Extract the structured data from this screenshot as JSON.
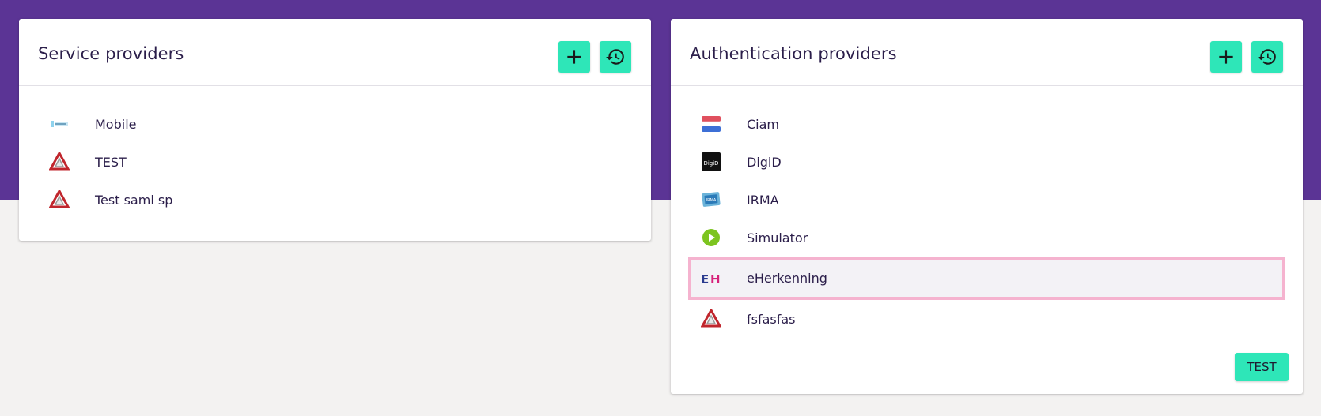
{
  "service_providers": {
    "title": "Service providers",
    "add_icon": "plus-icon",
    "history_icon": "history-icon",
    "items": [
      {
        "label": "Mobile",
        "icon": "mobile-logo-icon"
      },
      {
        "label": "TEST",
        "icon": "saml-logo-icon"
      },
      {
        "label": "Test saml sp",
        "icon": "saml-logo-icon"
      }
    ]
  },
  "authentication_providers": {
    "title": "Authentication providers",
    "add_icon": "plus-icon",
    "history_icon": "history-icon",
    "items": [
      {
        "label": "Ciam",
        "icon": "dutch-flag-icon"
      },
      {
        "label": "DigiD",
        "icon": "digid-logo-icon",
        "logo_text": "DigiD"
      },
      {
        "label": "IRMA",
        "icon": "irma-logo-icon",
        "logo_text": "IRMA"
      },
      {
        "label": "Simulator",
        "icon": "simulator-logo-icon"
      },
      {
        "label": "eHerkenning",
        "icon": "eherkenning-logo-icon",
        "logo_text": "EH",
        "selected": true
      },
      {
        "label": "fsfasfas",
        "icon": "saml-logo-icon"
      }
    ],
    "test_button": "TEST"
  },
  "colors": {
    "banner": "#5b3495",
    "accent": "#2ee6b8",
    "selection_border": "#f5b3cf",
    "text": "#2b1e4a"
  }
}
